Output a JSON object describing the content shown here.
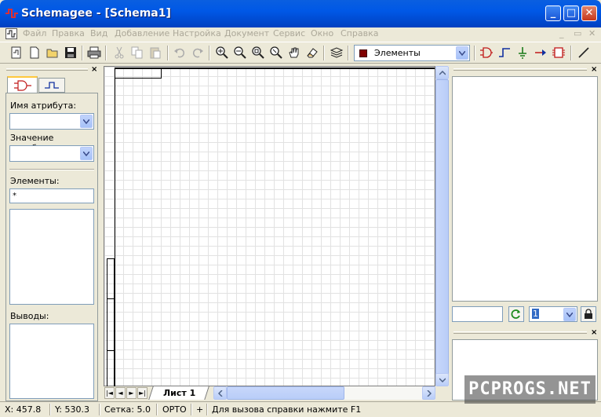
{
  "window": {
    "title": "Schemagee - [Schema1]",
    "controls": {
      "minimize": "_",
      "maximize": "□",
      "close": "✕"
    }
  },
  "menu": {
    "items": [
      "Файл",
      "Правка",
      "Вид",
      "Добавление",
      "Настройка",
      "Документ",
      "Сервис",
      "Окно",
      "Справка"
    ],
    "mdi_controls": [
      "_",
      "▭",
      "✕"
    ]
  },
  "toolbar": {
    "buttons": [
      "new-schema-icon",
      "new-document-icon",
      "open-folder-icon",
      "save-disk-icon",
      "print-icon",
      "cut-icon",
      "copy-icon",
      "paste-icon",
      "undo-icon",
      "redo-icon",
      "zoom-in-icon",
      "zoom-out-icon",
      "zoom-fit-icon",
      "zoom-window-icon",
      "pan-hand-icon",
      "eraser-icon",
      "layers-icon",
      "gate-icon",
      "pulse-icon",
      "ground-icon",
      "pin-arrow-icon",
      "chip-icon",
      "line-tool-icon"
    ],
    "layer_combo": {
      "value": "Элементы",
      "swatch_color": "#800000"
    }
  },
  "left_panel": {
    "close": "×",
    "attr_name_label": "Имя атрибута:",
    "attr_value_label": "Значение атрибута:",
    "elements_label": "Элементы:",
    "elements_filter": "*",
    "pins_label": "Выводы:"
  },
  "canvas": {
    "sheet_tab": "Лист 1",
    "nav": [
      "|◄",
      "◄",
      "►",
      "►|"
    ]
  },
  "right_panel": {
    "close_top": "×",
    "close_bottom": "×",
    "spin_value": "1"
  },
  "status": {
    "x": "X: 457.8",
    "y": "Y: 530.3",
    "grid": "Сетка: 5.0",
    "ortho": "ОРТО",
    "snap": "+",
    "help": "Для вызова справки нажмите F1"
  },
  "watermark": "PCPROGS.NET",
  "colors": {
    "titlebar": "#0058E6",
    "face": "#ECE9D8",
    "accent": "#800000"
  }
}
